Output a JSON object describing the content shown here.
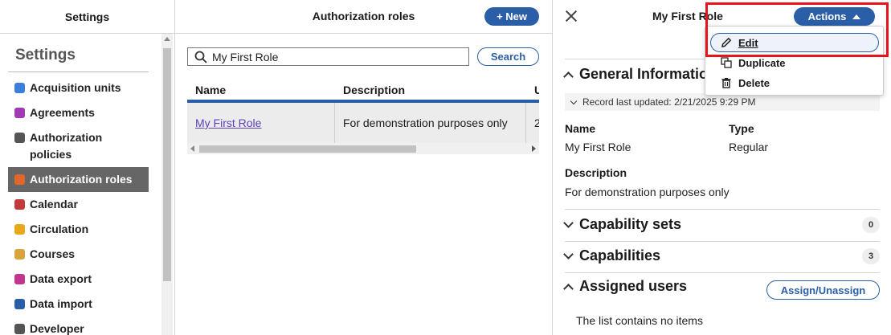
{
  "settings_pane": {
    "header": "Settings",
    "title": "Settings",
    "nav_items": [
      {
        "label": "Acquisition units",
        "icon": "acquisition-units-icon",
        "color": "#3b7fd9",
        "active": false
      },
      {
        "label": "Agreements",
        "icon": "agreements-icon",
        "color": "#a23ab4",
        "active": false
      },
      {
        "label": "Authorization policies",
        "icon": "gear-icon",
        "color": "#555555",
        "active": false
      },
      {
        "label": "Authorization roles",
        "icon": "user-role-icon",
        "color": "#e0662a",
        "active": true
      },
      {
        "label": "Calendar",
        "icon": "calendar-icon",
        "color": "#c23b3b",
        "active": false
      },
      {
        "label": "Circulation",
        "icon": "circulation-icon",
        "color": "#e8a81a",
        "active": false
      },
      {
        "label": "Courses",
        "icon": "courses-icon",
        "color": "#d9a43a",
        "active": false
      },
      {
        "label": "Data export",
        "icon": "data-export-icon",
        "color": "#c2368f",
        "active": false
      },
      {
        "label": "Data import",
        "icon": "data-import-icon",
        "color": "#2a5ea7",
        "active": false
      },
      {
        "label": "Developer",
        "icon": "developer-icon",
        "color": "#555555",
        "active": false
      }
    ]
  },
  "roles_pane": {
    "title": "Authorization roles",
    "new_label": "+ New",
    "search_value": "My First Role",
    "search_label": "Search",
    "columns": [
      "Name",
      "Description",
      "U"
    ],
    "rows": [
      {
        "name": "My First Role",
        "description": "For demonstration purposes only",
        "u": "2"
      }
    ]
  },
  "detail_pane": {
    "title": "My First Role",
    "actions_label": "Actions",
    "general_header": "General Information",
    "record_meta": "Record last updated: 2/21/2025 9:29 PM",
    "name_label": "Name",
    "name_value": "My First Role",
    "type_label": "Type",
    "type_value": "Regular",
    "description_label": "Description",
    "description_value": "For demonstration purposes only",
    "capability_sets_header": "Capability sets",
    "capability_sets_count": "0",
    "capabilities_header": "Capabilities",
    "capabilities_count": "3",
    "assigned_users_header": "Assigned users",
    "assign_label": "Assign/Unassign",
    "empty_message": "The list contains no items"
  },
  "actions_menu": {
    "items": [
      {
        "label": "Edit",
        "icon": "pencil-icon",
        "focused": true
      },
      {
        "label": "Duplicate",
        "icon": "duplicate-icon",
        "focused": false
      },
      {
        "label": "Delete",
        "icon": "trash-icon",
        "focused": false
      }
    ]
  }
}
